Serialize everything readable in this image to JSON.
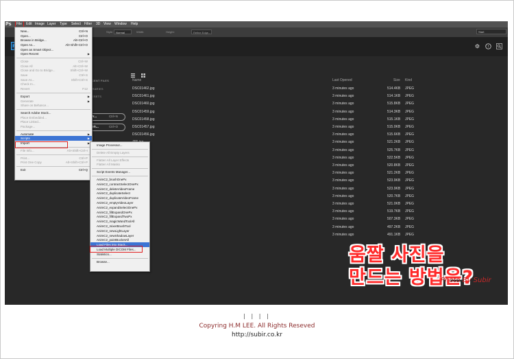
{
  "app": {
    "logo": "Ps"
  },
  "menubar": [
    "File",
    "Edit",
    "Image",
    "Layer",
    "Type",
    "Select",
    "Filter",
    "3D",
    "View",
    "Window",
    "Help"
  ],
  "options": {
    "style_label": "Style:",
    "style_value": "Normal",
    "width_label": "Width:",
    "height_label": "Height:",
    "refine_label": "Refine Edge...",
    "mode_value": "Start"
  },
  "start": {
    "recent_files": "RECENT FILES",
    "libraries": "LIBRARIES",
    "presets": "PRESETS",
    "new_btn": "New...",
    "new_sc": "Ctrl+N",
    "open_btn": "Open...",
    "open_sc": "Ctrl+O"
  },
  "columns": {
    "name": "Name",
    "last_opened": "Last Opened",
    "size": "Size",
    "kind": "Kind"
  },
  "files": [
    {
      "name": "DSC01462.jpg",
      "opened": "3 minutes ago",
      "size": "514.4KB",
      "kind": "JPEG"
    },
    {
      "name": "DSC01461.jpg",
      "opened": "3 minutes ago",
      "size": "514.1KB",
      "kind": "JPEG"
    },
    {
      "name": "DSC01460.jpg",
      "opened": "3 minutes ago",
      "size": "515.8KB",
      "kind": "JPEG"
    },
    {
      "name": "DSC01459.jpg",
      "opened": "3 minutes ago",
      "size": "514.3KB",
      "kind": "JPEG"
    },
    {
      "name": "DSC01458.jpg",
      "opened": "3 minutes ago",
      "size": "515.1KB",
      "kind": "JPEG"
    },
    {
      "name": "DSC01457.jpg",
      "opened": "3 minutes ago",
      "size": "515.0KB",
      "kind": "JPEG"
    },
    {
      "name": "DSC01456.jpg",
      "opened": "3 minutes ago",
      "size": "515.6KB",
      "kind": "JPEG"
    },
    {
      "name": "455.jpg",
      "opened": "3 minutes ago",
      "size": "521.2KB",
      "kind": "JPEG"
    },
    {
      "name": "454.jpg",
      "opened": "3 minutes ago",
      "size": "525.7KB",
      "kind": "JPEG"
    },
    {
      "name": "453.jpg",
      "opened": "3 minutes ago",
      "size": "522.5KB",
      "kind": "JPEG"
    },
    {
      "name": "452.jpg",
      "opened": "3 minutes ago",
      "size": "520.8KB",
      "kind": "JPEG"
    },
    {
      "name": "451.jpg",
      "opened": "3 minutes ago",
      "size": "521.2KB",
      "kind": "JPEG"
    },
    {
      "name": "450.jpg",
      "opened": "3 minutes ago",
      "size": "523.9KB",
      "kind": "JPEG"
    },
    {
      "name": "449.jpg",
      "opened": "3 minutes ago",
      "size": "523.9KB",
      "kind": "JPEG"
    },
    {
      "name": "448.jpg",
      "opened": "3 minutes ago",
      "size": "520.7KB",
      "kind": "JPEG"
    },
    {
      "name": "447.jpg",
      "opened": "3 minutes ago",
      "size": "521.0KB",
      "kind": "JPEG"
    },
    {
      "name": "446.jpg",
      "opened": "3 minutes ago",
      "size": "519.7KB",
      "kind": "JPEG"
    },
    {
      "name": "445.jpg",
      "opened": "3 minutes ago",
      "size": "507.3KB",
      "kind": "JPEG"
    },
    {
      "name": "444.jpg",
      "opened": "3 minutes ago",
      "size": "497.2KB",
      "kind": "JPEG"
    },
    {
      "name": "443.jpg",
      "opened": "3 minutes ago",
      "size": "491.1KB",
      "kind": "JPEG"
    }
  ],
  "file_menu": [
    {
      "label": "New...",
      "sc": "Ctrl+N"
    },
    {
      "label": "Open...",
      "sc": "Ctrl+O"
    },
    {
      "label": "Browse in Bridge...",
      "sc": "Alt+Ctrl+O"
    },
    {
      "label": "Open As...",
      "sc": "Alt+Shift+Ctrl+O"
    },
    {
      "label": "Open as Smart Object..."
    },
    {
      "label": "Open Recent",
      "sub": true
    },
    {
      "sep": true
    },
    {
      "label": "Close",
      "sc": "Ctrl+W",
      "dis": true
    },
    {
      "label": "Close All",
      "sc": "Alt+Ctrl+W",
      "dis": true
    },
    {
      "label": "Close and Go to Bridge...",
      "sc": "Shift+Ctrl+W",
      "dis": true
    },
    {
      "label": "Save",
      "sc": "Ctrl+S",
      "dis": true
    },
    {
      "label": "Save As...",
      "sc": "Shift+Ctrl+S",
      "dis": true
    },
    {
      "label": "Check In...",
      "dis": true
    },
    {
      "label": "Revert",
      "sc": "F12",
      "dis": true
    },
    {
      "sep": true
    },
    {
      "label": "Export",
      "sub": true
    },
    {
      "label": "Generate",
      "sub": true,
      "dis": true
    },
    {
      "label": "Share on Behance...",
      "dis": true
    },
    {
      "sep": true
    },
    {
      "label": "Search Adobe Stock..."
    },
    {
      "label": "Place Embedded...",
      "dis": true
    },
    {
      "label": "Place Linked...",
      "dis": true
    },
    {
      "label": "Package...",
      "dis": true
    },
    {
      "sep": true
    },
    {
      "label": "Automate",
      "sub": true
    },
    {
      "label": "Scripts",
      "sub": true,
      "hl": true
    },
    {
      "label": "Import",
      "sub": true
    },
    {
      "sep": true
    },
    {
      "label": "File Info...",
      "sc": "Alt+Shift+Ctrl+I",
      "dis": true
    },
    {
      "sep": true
    },
    {
      "label": "Print...",
      "sc": "Ctrl+P",
      "dis": true
    },
    {
      "label": "Print One Copy",
      "sc": "Alt+Shift+Ctrl+P",
      "dis": true
    },
    {
      "sep": true
    },
    {
      "label": "Exit",
      "sc": "Ctrl+Q"
    }
  ],
  "scripts_menu": [
    {
      "label": "Image Processor..."
    },
    {
      "sep": true
    },
    {
      "label": "Delete All Empty Layers",
      "dis": true
    },
    {
      "sep": true
    },
    {
      "label": "Flatten All Layer Effects",
      "dis": true
    },
    {
      "label": "Flatten All Masks",
      "dis": true
    },
    {
      "sep": true
    },
    {
      "label": "Script Events Manager..."
    },
    {
      "sep": true
    },
    {
      "label": "AnimC2_brushOnePx"
    },
    {
      "label": "AnimC2_contractSelectOnePx"
    },
    {
      "label": "AnimC2_deleteVideoFrame"
    },
    {
      "label": "AnimC2_duplicateSelect"
    },
    {
      "label": "AnimC2_duplicateVideoFrame"
    },
    {
      "label": "AnimC2_emptyVideoLayer"
    },
    {
      "label": "AnimC2_expandSelectOnePx"
    },
    {
      "label": "AnimC2_fillExpandOnePx"
    },
    {
      "label": "AnimC2_fillExpandTwoPx"
    },
    {
      "label": "AnimC2_magicWandToolAll"
    },
    {
      "label": "AnimC2_mixerBrushTool"
    },
    {
      "label": "AnimC2_newLightLayer"
    },
    {
      "label": "AnimC2_newShadowLayer"
    },
    {
      "label": "AnimC2_paintBucketAll"
    },
    {
      "label": "Load Files into Stack...",
      "hl": true
    },
    {
      "label": "Load Multiple DICOM Files..."
    },
    {
      "label": "Statistics..."
    },
    {
      "sep": true
    },
    {
      "label": "Browse..."
    }
  ],
  "overlay": {
    "line1": "움짤 사진을",
    "line2": "만드는 방법은?",
    "photo_by": "Photo By Subir"
  },
  "footer": {
    "bars": "| | | |",
    "copyright": "Copyring H.M LEE. All Rights Reseved",
    "url": "http://subir.co.kr"
  },
  "colors": {
    "accent_red": "#e02020",
    "menu_highlight": "#3c74d4",
    "ps_blue": "#31a8ff"
  }
}
